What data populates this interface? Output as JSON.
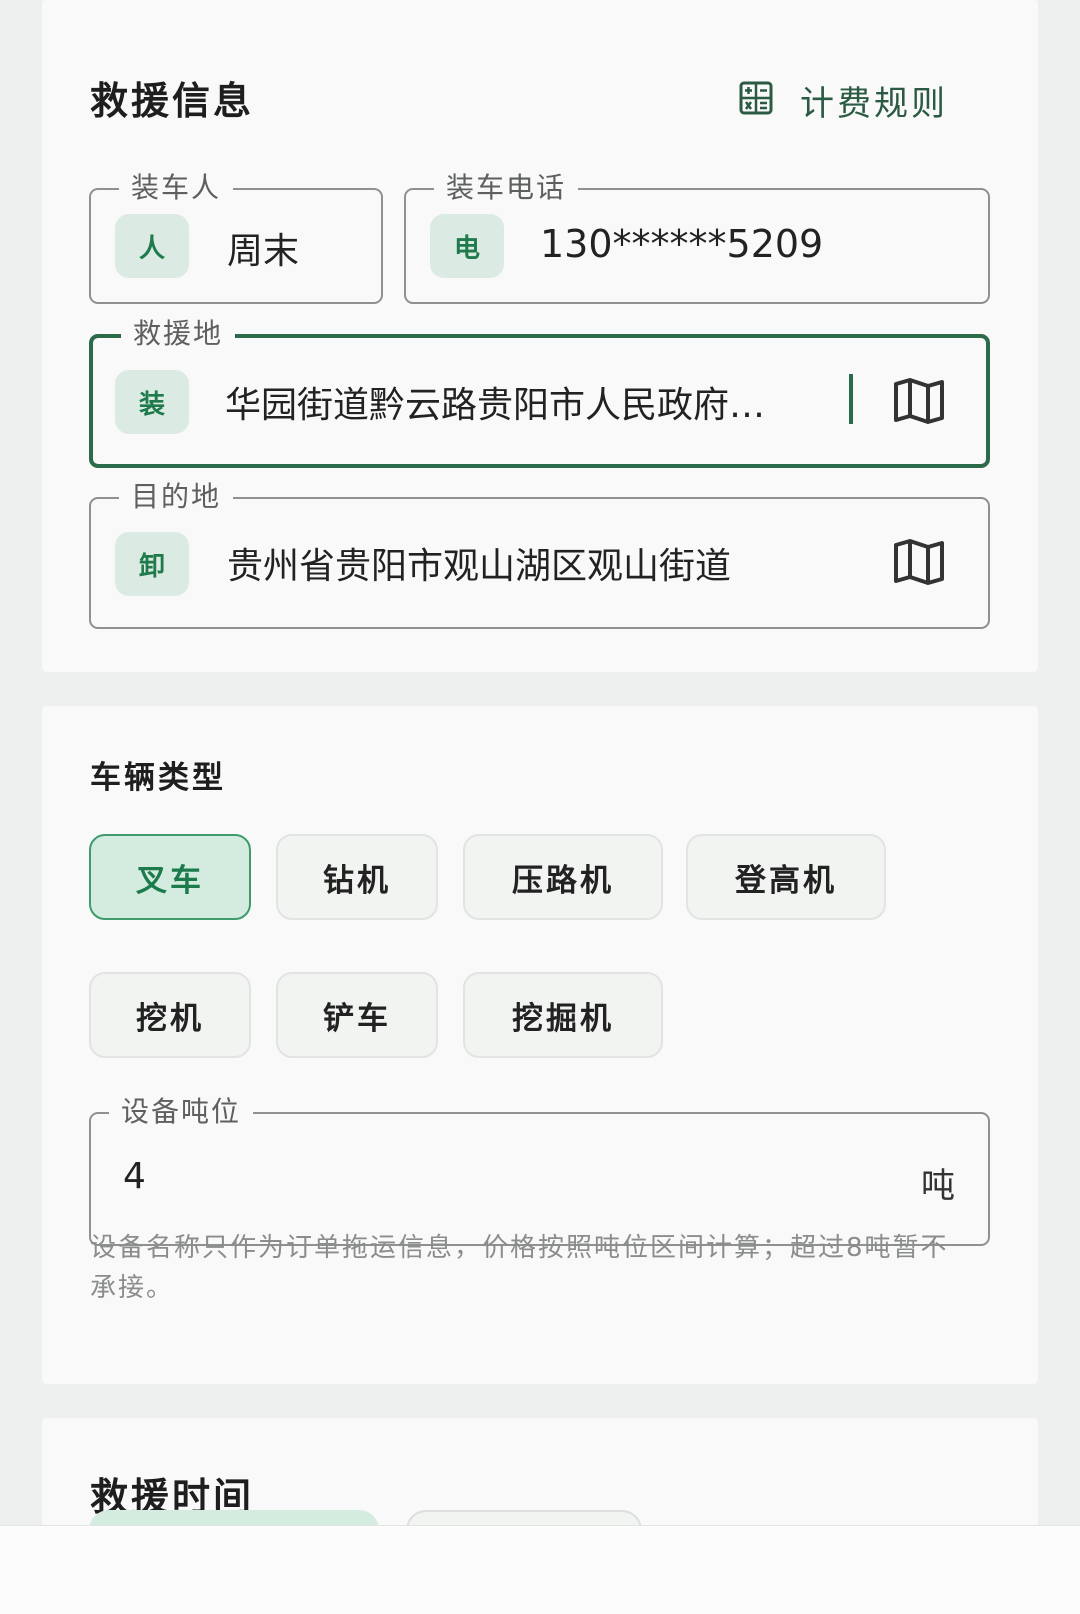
{
  "rescue_info": {
    "title": "救援信息",
    "fee_rules_label": "计费规则",
    "loader_name": {
      "legend": "装车人",
      "badge": "人",
      "value": "周末"
    },
    "loader_phone": {
      "legend": "装车电话",
      "badge": "电",
      "value": "130******5209"
    },
    "rescue_location": {
      "legend": "救援地",
      "badge": "装",
      "value": "…华园街道黔云路贵阳市人民政府"
    },
    "destination": {
      "legend": "目的地",
      "badge": "卸",
      "value": "贵州省贵阳市观山湖区观山街道"
    }
  },
  "vehicle_type": {
    "title": "车辆类型",
    "options": [
      "叉车",
      "钻机",
      "压路机",
      "登高机",
      "挖机",
      "铲车",
      "挖掘机"
    ],
    "selected": "叉车",
    "tonnage": {
      "legend": "设备吨位",
      "value": "4",
      "unit": "吨"
    },
    "hint": "设备名称只作为订单拖运信息，价格按照吨位区间计算；超过8吨暂不承接。"
  },
  "rescue_time": {
    "title": "救援时间"
  },
  "colors": {
    "accent": "#2c6b4a",
    "badge_bg": "#dbeae2",
    "chip_selected_bg": "#d4ece0"
  },
  "icons": [
    "calculator-icon",
    "map-icon"
  ]
}
